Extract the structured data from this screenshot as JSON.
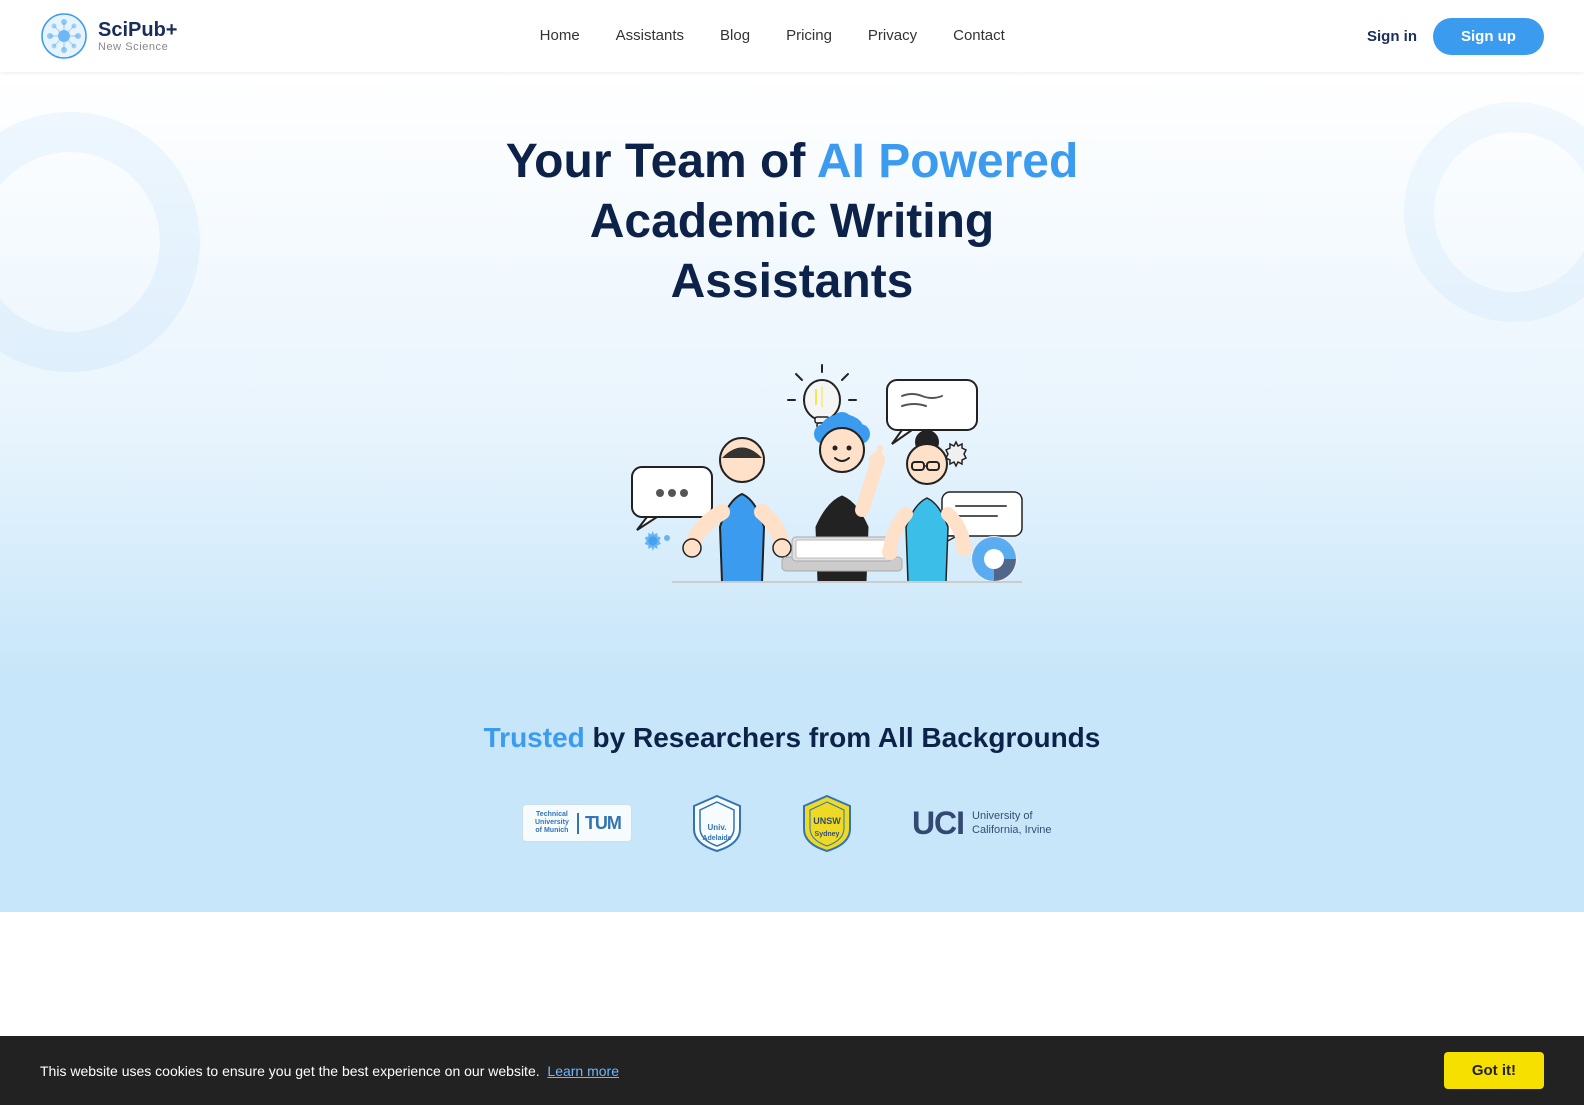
{
  "navbar": {
    "logo_main": "SciPub+",
    "logo_plus": "+",
    "logo_sub": "New Science",
    "nav_items": [
      {
        "label": "Home",
        "href": "#"
      },
      {
        "label": "Assistants",
        "href": "#"
      },
      {
        "label": "Blog",
        "href": "#"
      },
      {
        "label": "Pricing",
        "href": "#"
      },
      {
        "label": "Privacy",
        "href": "#"
      },
      {
        "label": "Contact",
        "href": "#"
      }
    ],
    "signin_label": "Sign in",
    "signup_label": "Sign up"
  },
  "hero": {
    "title_part1": "Your Team of ",
    "title_highlight": "AI Powered",
    "title_part2": "Academic Writing",
    "title_part3": "Assistants"
  },
  "trusted": {
    "label_colored": "Trusted",
    "label_rest": " by Researchers from All Backgrounds",
    "universities": [
      {
        "name": "Technical University of Munich",
        "abbr": "TUM"
      },
      {
        "name": "University of Adelaide",
        "abbr": "Adelaide"
      },
      {
        "name": "UNSW Sydney",
        "abbr": "UNSW"
      },
      {
        "name": "University of California, Irvine",
        "abbr": "UCI"
      }
    ]
  },
  "cookie": {
    "text": "This website uses cookies to ensure you get the best experience on our website.",
    "link_text": "Learn more",
    "button_label": "Got it!"
  }
}
